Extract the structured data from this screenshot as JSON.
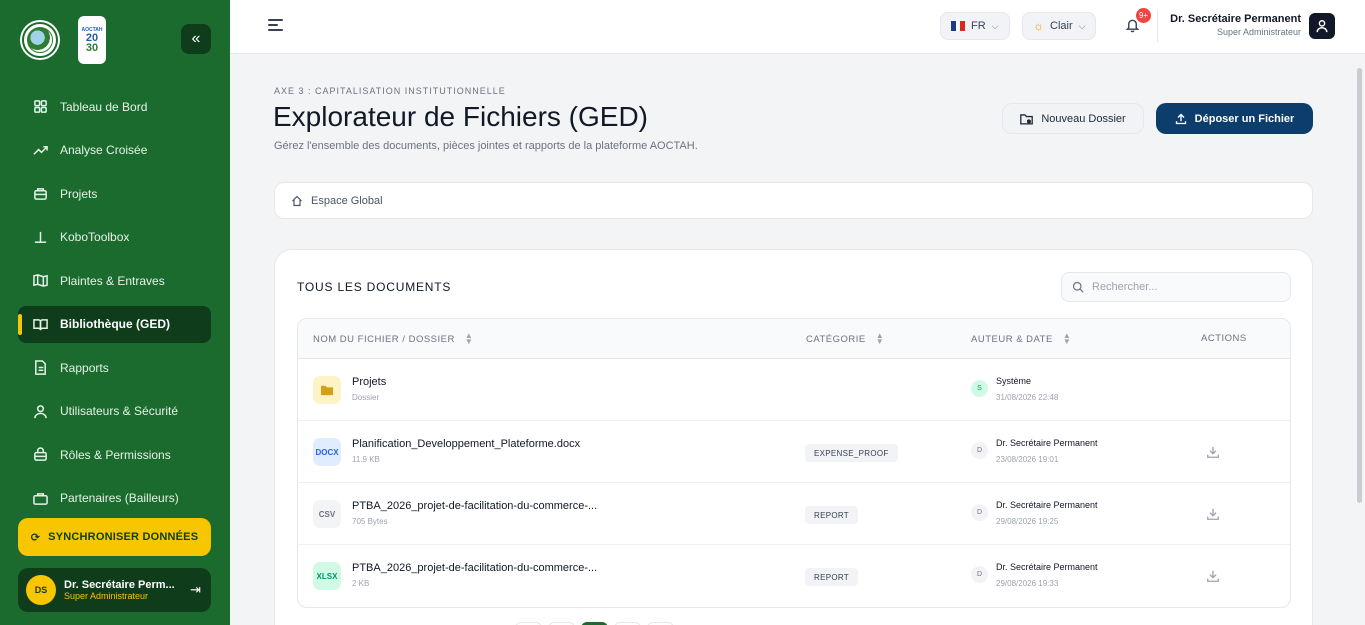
{
  "sidebar": {
    "logo1": "logo-emblem",
    "logo2": {
      "top": "AOCTAH",
      "mid1": "20",
      "mid2": "30"
    },
    "items": [
      {
        "label": "Tableau de Bord",
        "icon": "grid-icon"
      },
      {
        "label": "Analyse Croisée",
        "icon": "trend-icon"
      },
      {
        "label": "Projets",
        "icon": "briefcase-icon"
      },
      {
        "label": "KoboToolbox",
        "icon": "anchor-icon"
      },
      {
        "label": "Plaintes & Entraves",
        "icon": "map-icon"
      },
      {
        "label": "Bibliothèque (GED)",
        "icon": "book-icon",
        "active": true
      },
      {
        "label": "Rapports",
        "icon": "receipt-icon"
      },
      {
        "label": "Utilisateurs & Sécurité",
        "icon": "users-icon"
      },
      {
        "label": "Rôles & Permissions",
        "icon": "lock-icon"
      },
      {
        "label": "Partenaires (Bailleurs)",
        "icon": "suitcase-icon"
      }
    ],
    "sync_label": "SYNCHRONISER DONNÉES",
    "user": {
      "initials": "DS",
      "name": "Dr. Secrétaire Perm...",
      "role": "Super Administrateur"
    }
  },
  "header": {
    "language": "FR",
    "theme": "Clair",
    "notifications": "9+",
    "user_name": "Dr. Secrétaire Permanent",
    "user_role": "Super Administrateur"
  },
  "page": {
    "overline": "AXE 3 : CAPITALISATION INSTITUTIONNELLE",
    "title": "Explorateur de Fichiers (GED)",
    "subtitle": "Gérez l'ensemble des documents, pièces jointes et rapports de la plateforme AOCTAH.",
    "new_folder_label": "Nouveau Dossier",
    "upload_label": "Déposer un Fichier",
    "breadcrumb": "Espace Global"
  },
  "documents": {
    "title": "TOUS LES DOCUMENTS",
    "search_placeholder": "Rechercher...",
    "columns": [
      "NOM DU FICHIER / DOSSIER",
      "CATÉGORIE",
      "AUTEUR & DATE",
      "ACTIONS"
    ],
    "rows": [
      {
        "type": "folder",
        "icon_label": "",
        "name": "Projets",
        "meta": "Dossier",
        "category": "",
        "author_initial": "S",
        "author": "Système",
        "date": "31/08/2026 22:48",
        "action": ""
      },
      {
        "type": "docx",
        "icon_label": "DOCX",
        "name": "Planification_Developpement_Plateforme.docx",
        "meta": "11.9 KB",
        "category": "EXPENSE_PROOF",
        "author_initial": "D",
        "author": "Dr. Secrétaire Permanent",
        "date": "23/08/2026 19:01",
        "action": "download-icon"
      },
      {
        "type": "csv",
        "icon_label": "CSV",
        "name": "PTBA_2026_projet-de-facilitation-du-commerce-...",
        "meta": "705 Bytes",
        "category": "REPORT",
        "author_initial": "D",
        "author": "Dr. Secrétaire Permanent",
        "date": "29/08/2026 19:25",
        "action": "download-icon"
      },
      {
        "type": "xlsx",
        "icon_label": "XLSX",
        "name": "PTBA_2026_projet-de-facilitation-du-commerce-...",
        "meta": "2 KB",
        "category": "REPORT",
        "author_initial": "D",
        "author": "Dr. Secrétaire Permanent",
        "date": "29/08/2026 19:33",
        "action": "download-icon"
      }
    ]
  },
  "colors": {
    "sidebar_bg": "#1b6b2e",
    "accent_yellow": "#f7c600",
    "primary_button": "#0d3d6b",
    "badge_red": "#ef4444"
  }
}
